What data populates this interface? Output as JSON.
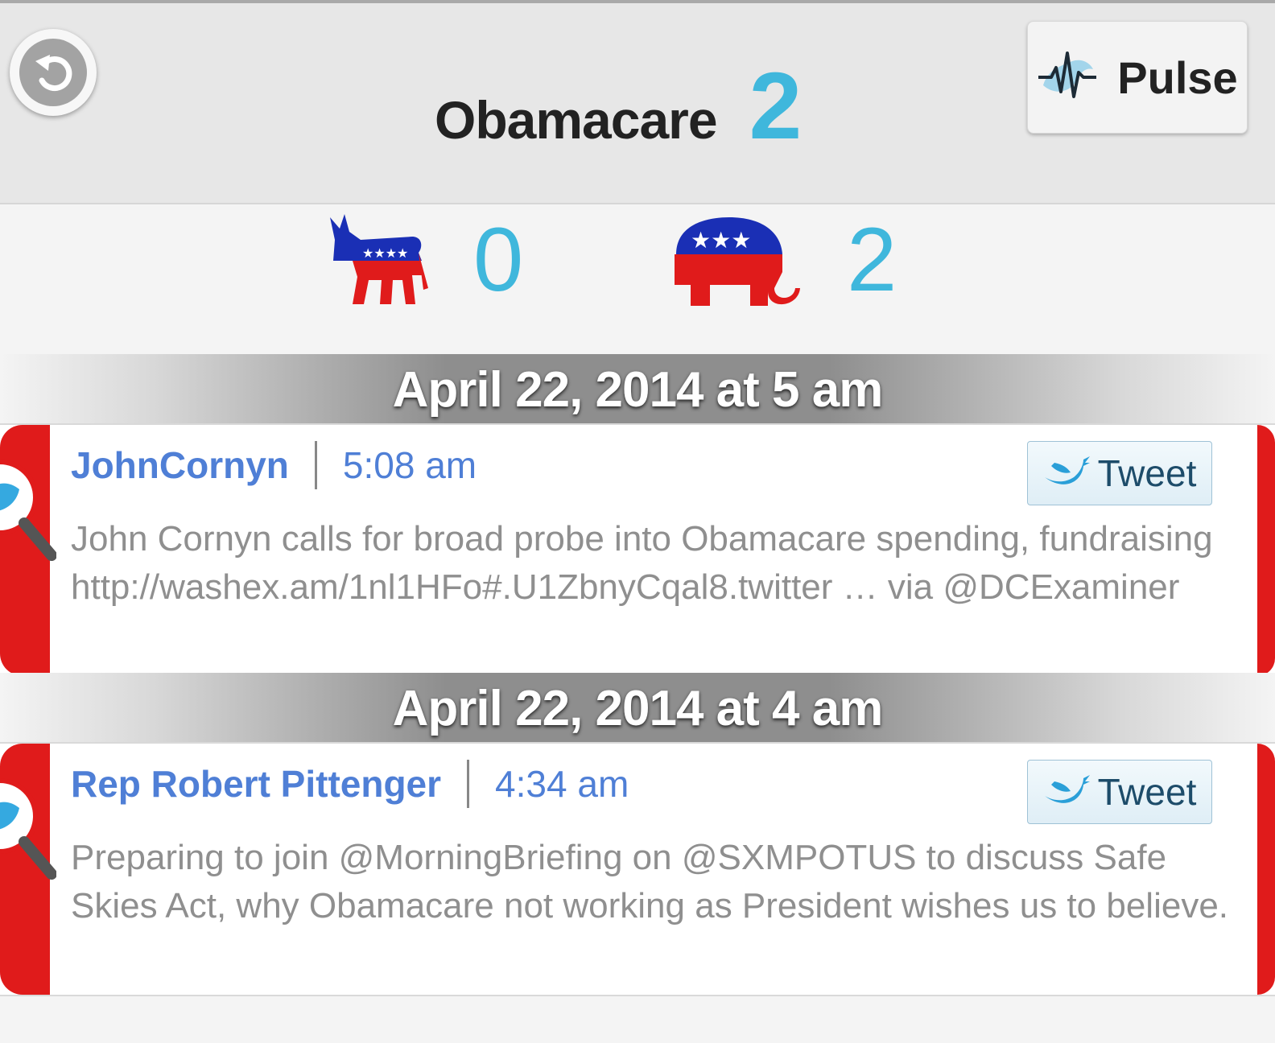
{
  "header": {
    "title": "Obamacare",
    "count": "2",
    "back_icon": "back-arrow-icon",
    "pulse_label": "Pulse",
    "pulse_icon": "pulse-waveform-icon"
  },
  "scores": {
    "democrat": {
      "icon": "democrat-donkey-icon",
      "count": "0"
    },
    "republican": {
      "icon": "republican-elephant-icon",
      "count": "2"
    }
  },
  "feed": [
    {
      "date_header": "April 22, 2014 at 5 am",
      "author": "JohnCornyn",
      "time": "5:08 am",
      "tweet_button": "Tweet",
      "text": "John Cornyn calls for broad probe into Obamacare spending, fundraising http://washex.am/1nl1HFo#.U1ZbnyCqal8.twitter … via @DCExaminer"
    },
    {
      "date_header": "April 22, 2014 at 4 am",
      "author": "Rep Robert Pittenger",
      "time": "4:34 am",
      "tweet_button": "Tweet",
      "text": "Preparing to join @MorningBriefing on @SXMPOTUS to discuss Safe Skies Act, why Obamacare not working as President wishes us to believe."
    }
  ],
  "colors": {
    "accent": "#3fb7dc",
    "republican_red": "#e01b1b",
    "democrat_blue": "#1a2fb5",
    "author_blue": "#4f7fd6"
  }
}
